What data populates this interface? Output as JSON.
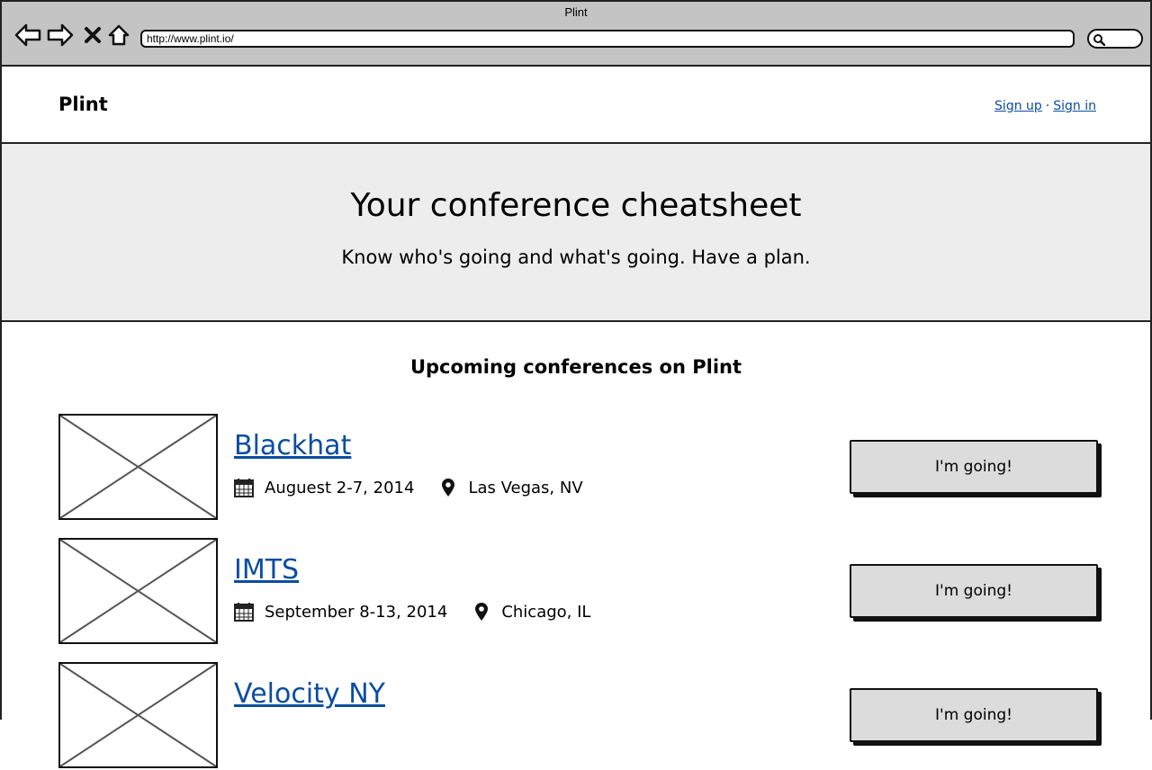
{
  "browser": {
    "title": "Plint",
    "url": "http://www.plint.io/"
  },
  "header": {
    "brand": "Plint",
    "sign_up": "Sign up",
    "separator": "·",
    "sign_in": "Sign in"
  },
  "hero": {
    "title": "Your conference cheatsheet",
    "subtitle": "Know who's going and what's going. Have a plan."
  },
  "main": {
    "section_title": "Upcoming conferences on Plint",
    "conferences": [
      {
        "name": "Blackhat",
        "date": "Auguest 2-7, 2014",
        "location": "Las Vegas, NV",
        "button": "I'm going!"
      },
      {
        "name": "IMTS",
        "date": "September 8-13, 2014",
        "location": "Chicago, IL",
        "button": "I'm going!"
      },
      {
        "name": "Velocity NY",
        "date": "",
        "location": "",
        "button": "I'm going!"
      }
    ]
  },
  "colors": {
    "link": "#0b4da1",
    "hero_bg": "#ededed",
    "chrome_bg": "#c4c4c4",
    "button_bg": "#dcdcdc"
  },
  "icons": [
    "back-arrow-icon",
    "forward-arrow-icon",
    "close-icon",
    "home-icon",
    "search-icon",
    "calendar-icon",
    "map-pin-icon",
    "image-placeholder-icon"
  ]
}
